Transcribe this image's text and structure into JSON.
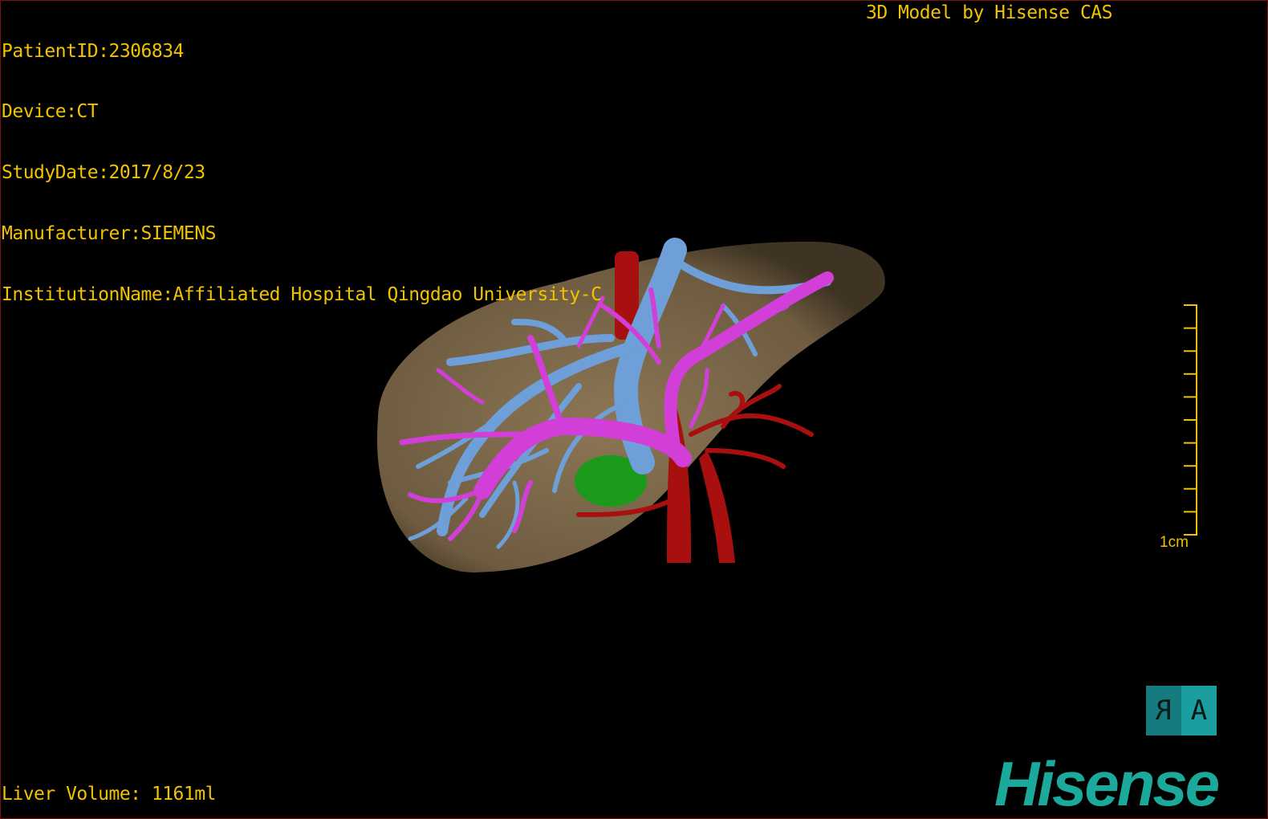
{
  "overlay": {
    "patient_id": "PatientID:2306834",
    "device": "Device:CT",
    "study_date": "StudyDate:2017/8/23",
    "manufacturer": "Manufacturer:SIEMENS",
    "institution": "InstitutionName:Affiliated Hospital Qingdao University-C",
    "credit": "3D Model by Hisense CAS",
    "liver_volume": "Liver Volume: 1161ml"
  },
  "scale_bar": {
    "label": "1cm",
    "ticks": 10
  },
  "orientation": {
    "left": "R",
    "right": "A"
  },
  "logo": "Hisense",
  "colors": {
    "text": "#f2c200",
    "liver": "#8a7352",
    "hepatic_vein": "#6f9fd8",
    "portal_vein": "#d23fd8",
    "artery": "#a81010",
    "gallbladder": "#1c9a1c",
    "brand": "#1aa99a"
  }
}
